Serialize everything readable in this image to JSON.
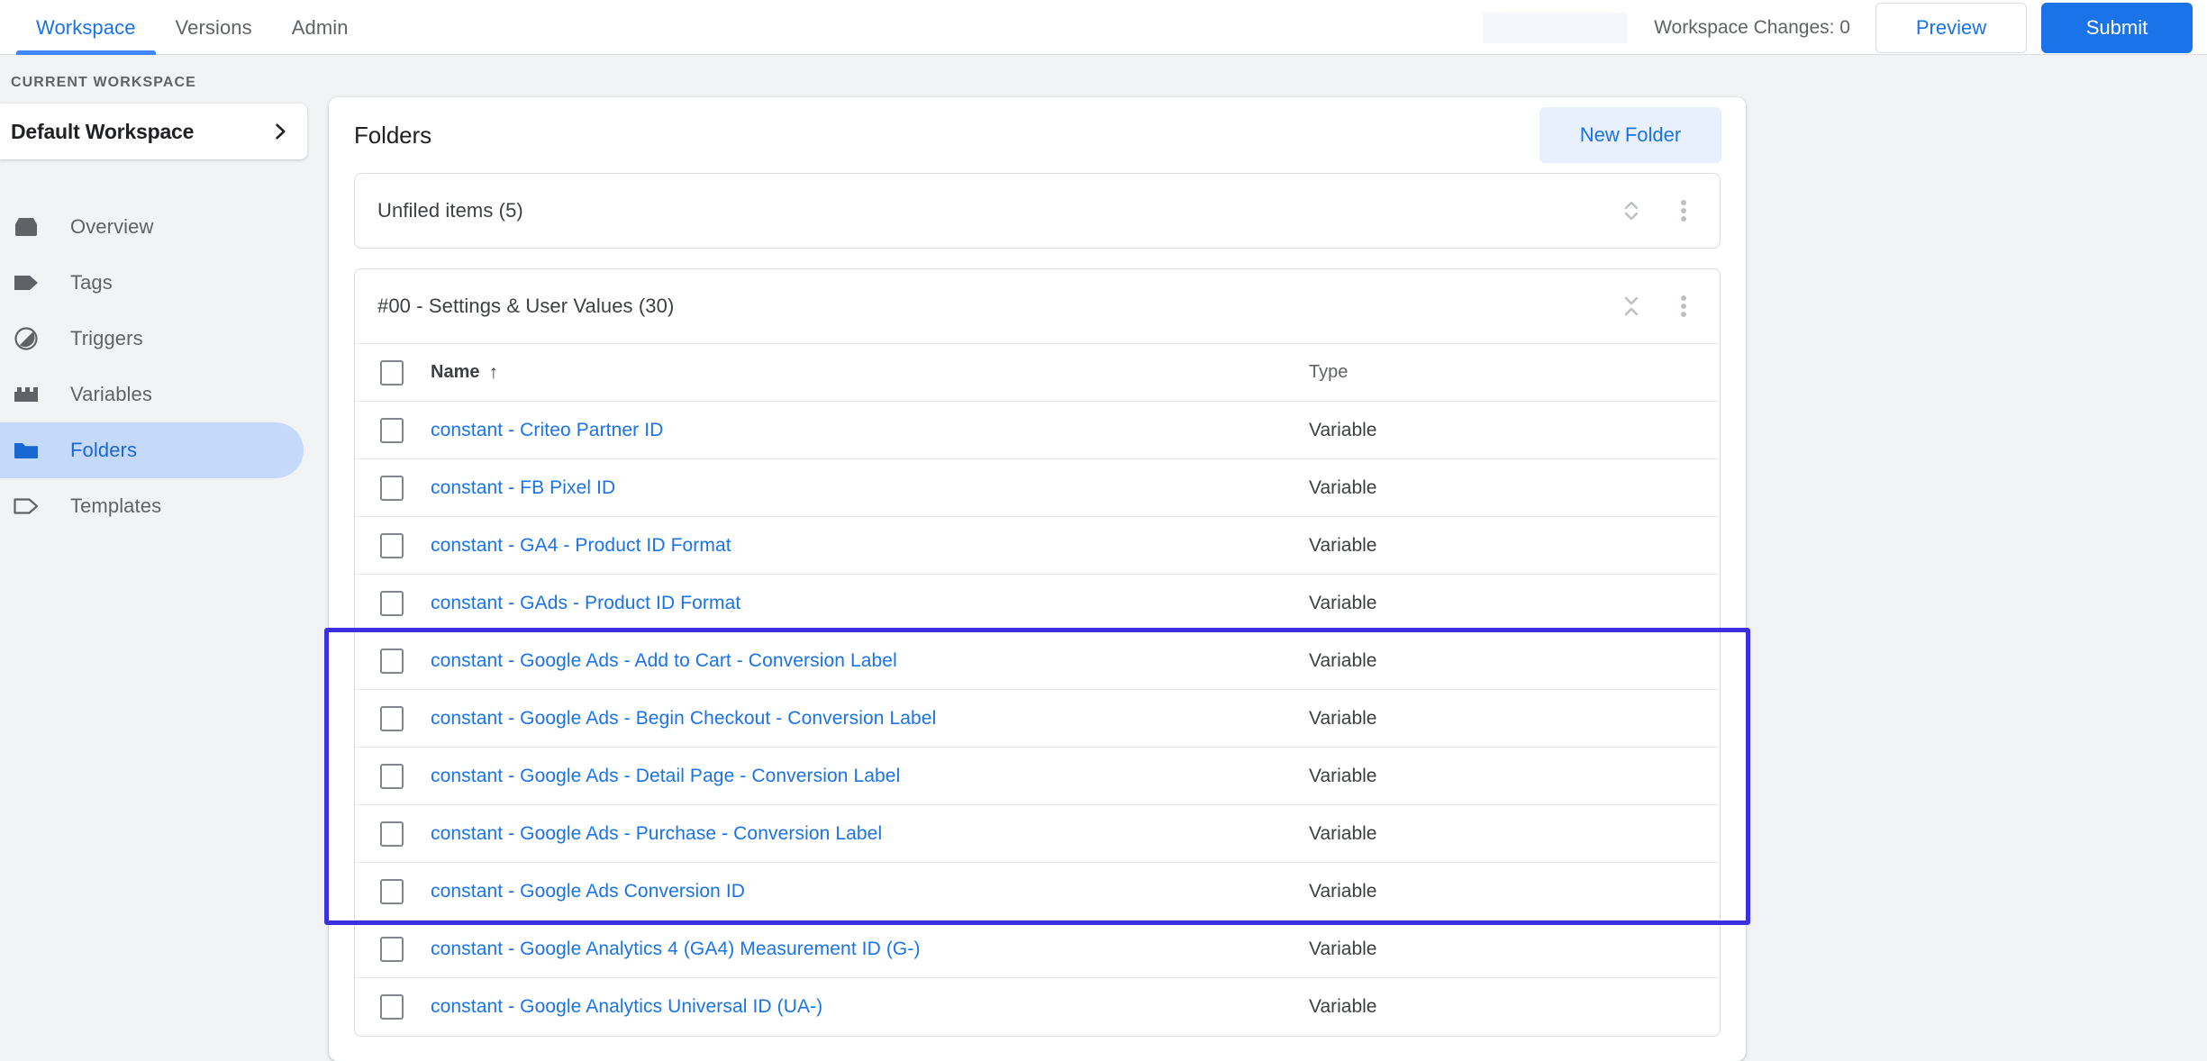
{
  "topbar": {
    "tabs": [
      {
        "label": "Workspace",
        "active": true
      },
      {
        "label": "Versions",
        "active": false
      },
      {
        "label": "Admin",
        "active": false
      }
    ],
    "workspace_changes": "Workspace Changes: 0",
    "preview_label": "Preview",
    "submit_label": "Submit"
  },
  "sidebar": {
    "section_label": "CURRENT WORKSPACE",
    "workspace_name": "Default Workspace",
    "items": [
      {
        "label": "Overview",
        "icon": "overview-icon",
        "active": false
      },
      {
        "label": "Tags",
        "icon": "tag-icon",
        "active": false
      },
      {
        "label": "Triggers",
        "icon": "trigger-icon",
        "active": false
      },
      {
        "label": "Variables",
        "icon": "variable-icon",
        "active": false
      },
      {
        "label": "Folders",
        "icon": "folder-icon",
        "active": true
      },
      {
        "label": "Templates",
        "icon": "template-icon",
        "active": false
      }
    ]
  },
  "main": {
    "title": "Folders",
    "new_folder_label": "New Folder",
    "folders": [
      {
        "name": "Unfiled items (5)",
        "expanded": false,
        "toggle_icon": "unfold-icon",
        "menu_icon": "more-vert-icon"
      },
      {
        "name": "#00 - Settings & User Values (30)",
        "expanded": true,
        "toggle_icon": "fold-icon",
        "menu_icon": "more-vert-icon"
      }
    ],
    "table": {
      "columns": [
        "Name",
        "Type"
      ],
      "sort_column": "Name",
      "sort_direction": "ascending",
      "sort_arrow": "↑",
      "rows": [
        {
          "name": "constant - Criteo Partner ID",
          "type": "Variable",
          "highlighted": false
        },
        {
          "name": "constant - FB Pixel ID",
          "type": "Variable",
          "highlighted": false
        },
        {
          "name": "constant - GA4 - Product ID Format",
          "type": "Variable",
          "highlighted": false
        },
        {
          "name": "constant - GAds - Product ID Format",
          "type": "Variable",
          "highlighted": false
        },
        {
          "name": "constant - Google Ads - Add to Cart - Conversion Label",
          "type": "Variable",
          "highlighted": true
        },
        {
          "name": "constant - Google Ads - Begin Checkout - Conversion Label",
          "type": "Variable",
          "highlighted": true
        },
        {
          "name": "constant - Google Ads - Detail Page - Conversion Label",
          "type": "Variable",
          "highlighted": true
        },
        {
          "name": "constant - Google Ads - Purchase - Conversion Label",
          "type": "Variable",
          "highlighted": true
        },
        {
          "name": "constant - Google Ads Conversion ID",
          "type": "Variable",
          "highlighted": true
        },
        {
          "name": "constant - Google Analytics 4 (GA4) Measurement ID (G-)",
          "type": "Variable",
          "highlighted": false
        },
        {
          "name": "constant - Google Analytics Universal ID (UA-)",
          "type": "Variable",
          "highlighted": false
        }
      ]
    }
  },
  "colors": {
    "accent_blue": "#1a73e8",
    "link_blue": "#1a73e8",
    "active_nav_bg": "#c5dafb",
    "highlight_border": "#3b2fe0",
    "page_bg": "#f1f3f4",
    "submit_bg": "#1a73e8"
  }
}
